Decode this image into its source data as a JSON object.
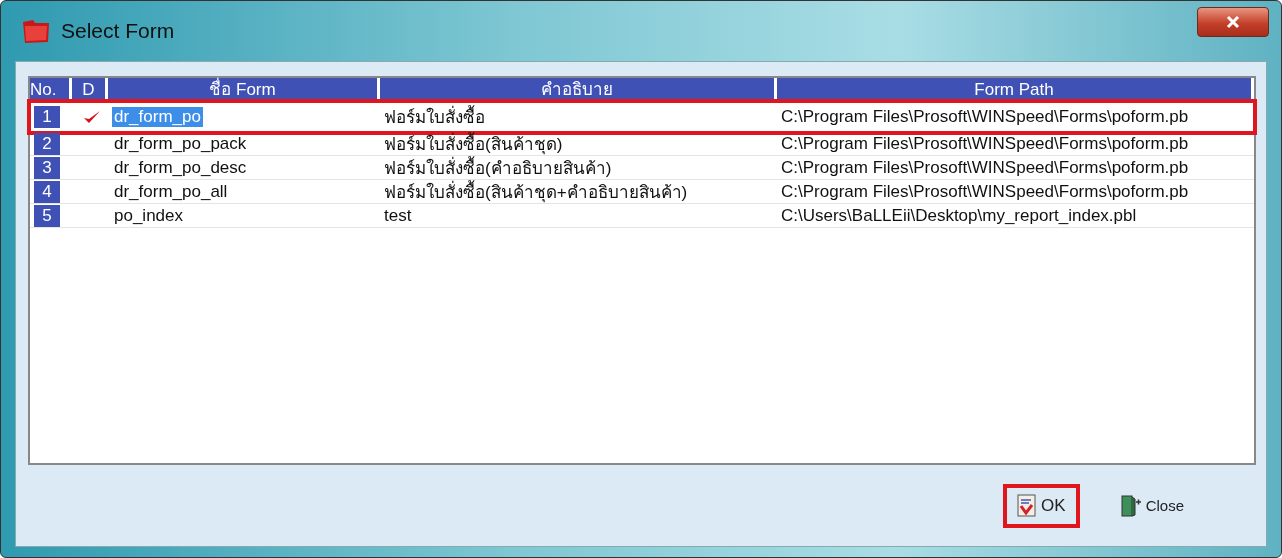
{
  "window": {
    "title": "Select Form"
  },
  "table": {
    "columns": [
      "No.",
      "D",
      "ชื่อ Form",
      "คำอธิบาย",
      "Form Path"
    ],
    "rows": [
      {
        "no": "1",
        "default": true,
        "selected": true,
        "marked": true,
        "name": "dr_form_po",
        "description": "ฟอร์มใบสั่งซื้อ",
        "path": "C:\\Program Files\\Prosoft\\WINSpeed\\Forms\\poform.pb"
      },
      {
        "no": "2",
        "default": false,
        "selected": false,
        "marked": false,
        "name": "dr_form_po_pack",
        "description": "ฟอร์มใบสั่งซื้อ(สินค้าชุด)",
        "path": "C:\\Program Files\\Prosoft\\WINSpeed\\Forms\\poform.pb"
      },
      {
        "no": "3",
        "default": false,
        "selected": false,
        "marked": false,
        "name": "dr_form_po_desc",
        "description": "ฟอร์มใบสั่งซื้อ(คำอธิบายสินค้า)",
        "path": "C:\\Program Files\\Prosoft\\WINSpeed\\Forms\\poform.pb"
      },
      {
        "no": "4",
        "default": false,
        "selected": false,
        "marked": false,
        "name": "dr_form_po_all",
        "description": "ฟอร์มใบสั่งซื้อ(สินค้าชุด+คำอธิบายสินค้า)",
        "path": "C:\\Program Files\\Prosoft\\WINSpeed\\Forms\\poform.pb"
      },
      {
        "no": "5",
        "default": false,
        "selected": false,
        "marked": false,
        "name": "po_index",
        "description": "test",
        "path": "C:\\Users\\BaLLEii\\Desktop\\my_report_index.pbl"
      }
    ]
  },
  "buttons": [
    {
      "kind": "ok",
      "label": "OK",
      "marked": true
    },
    {
      "kind": "close",
      "label": "Close",
      "marked": false
    }
  ]
}
